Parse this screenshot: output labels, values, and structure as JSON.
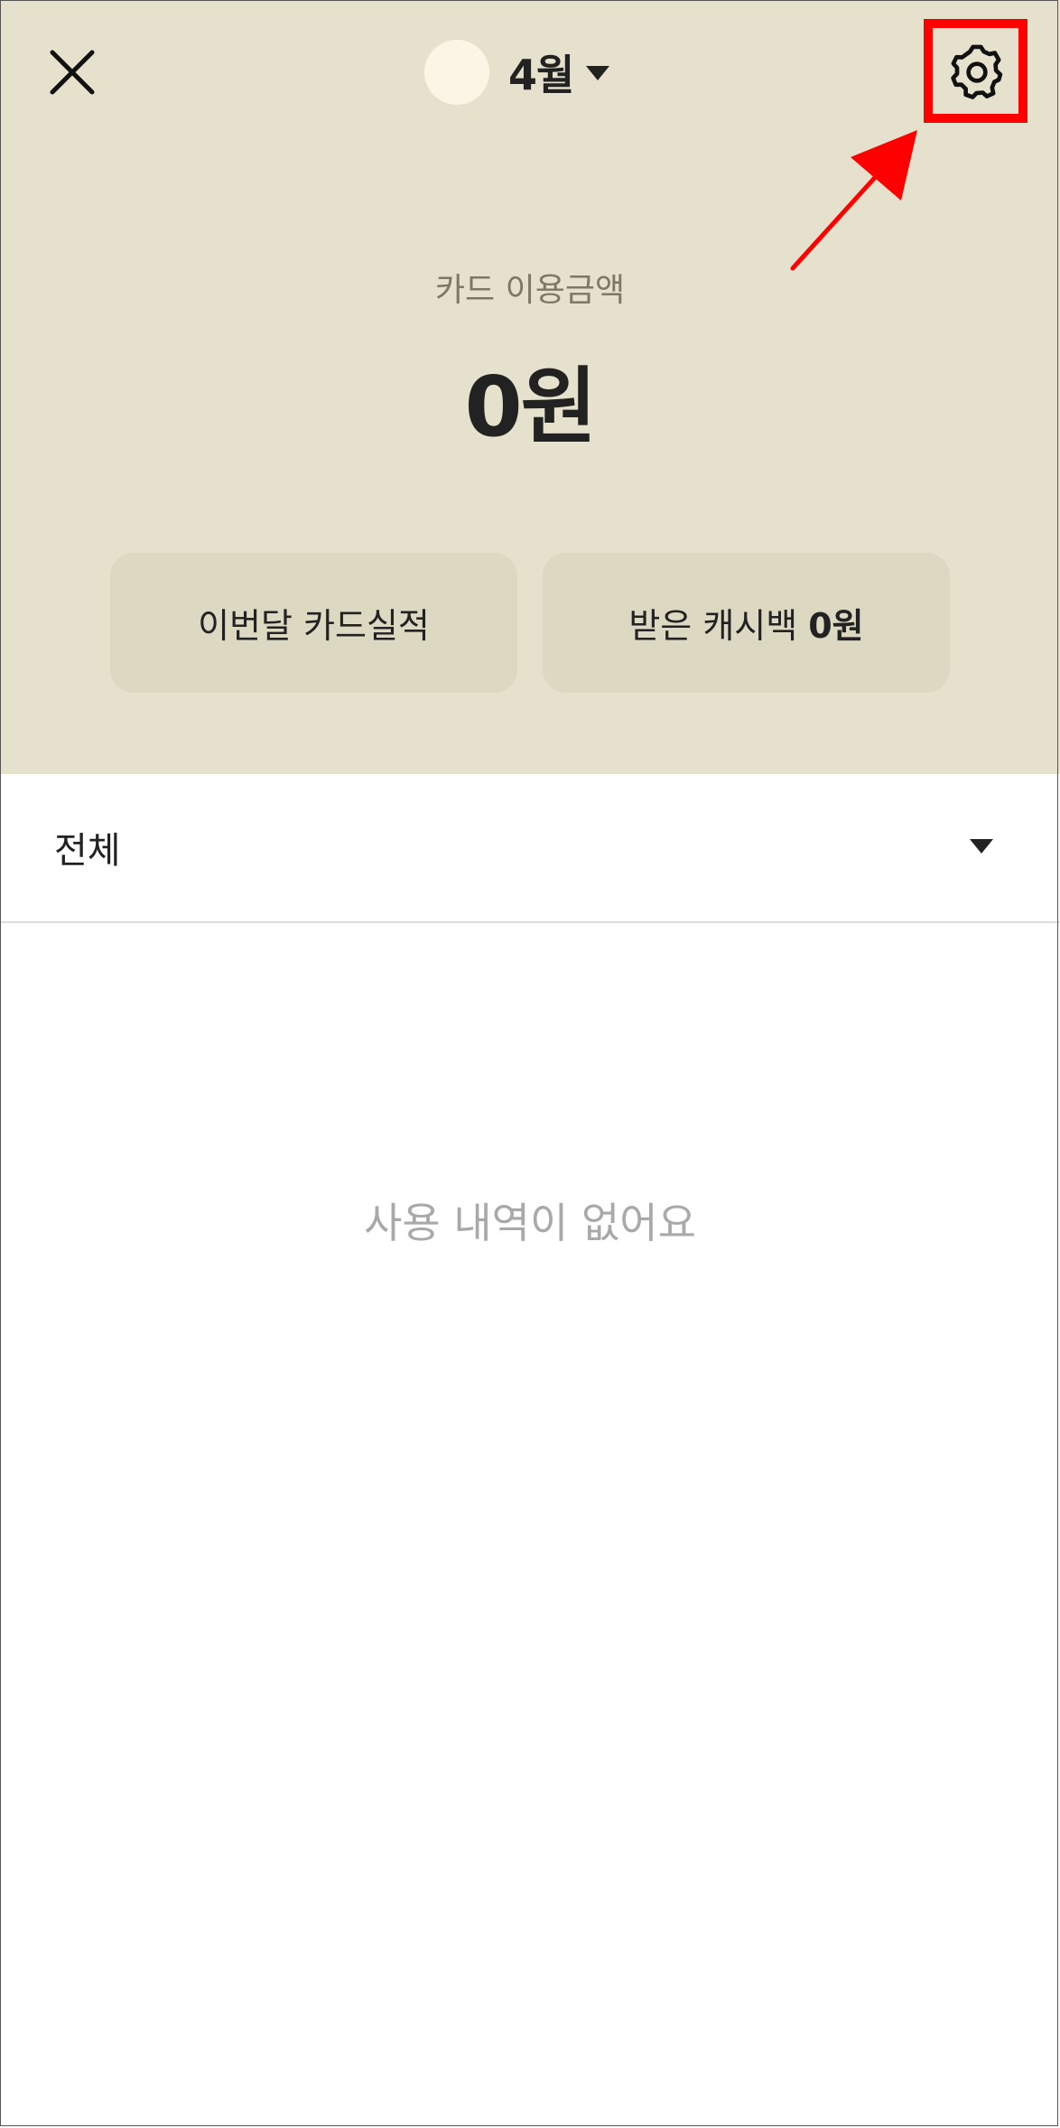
{
  "header": {
    "month_label": "4월",
    "icons": {
      "close": "close-icon",
      "caret": "caret-down-icon",
      "settings": "gear-icon"
    }
  },
  "summary": {
    "caption": "카드 이용금액",
    "amount": "0원"
  },
  "buttons": {
    "card_performance_label": "이번달 카드실적",
    "cashback_label": "받은 캐시백",
    "cashback_amount": "0원"
  },
  "filter": {
    "selected": "전체"
  },
  "empty_state": {
    "message": "사용 내역이 없어요"
  },
  "colors": {
    "panel_background": "#e5e1cc",
    "pill_background": "#dcd8c2",
    "highlight": "#ff0000"
  }
}
